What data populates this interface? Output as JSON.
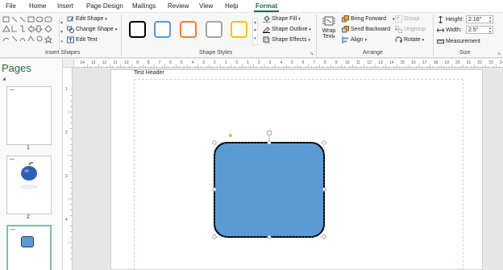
{
  "tabs": [
    {
      "label": "File"
    },
    {
      "label": "Home"
    },
    {
      "label": "Insert"
    },
    {
      "label": "Page Design"
    },
    {
      "label": "Mailings"
    },
    {
      "label": "Review"
    },
    {
      "label": "View"
    },
    {
      "label": "Help"
    },
    {
      "label": "Format",
      "active": true
    }
  ],
  "ribbon": {
    "insert_shapes": {
      "label": "Insert Shapes",
      "edit_shape": "Edit Shape",
      "change_shape": "Change Shape",
      "edit_text": "Edit Text"
    },
    "shape_styles": {
      "label": "Shape Styles",
      "swatch_colors": [
        "#000000",
        "#5b9bd5",
        "#ed7d31",
        "#a5a5a5",
        "#ffc000"
      ],
      "shape_fill": "Shape Fill",
      "shape_outline": "Shape Outline",
      "shape_effects": "Shape Effects"
    },
    "arrange": {
      "label": "Arrange",
      "wrap_text_line1": "Wrap",
      "wrap_text_line2": "Text",
      "bring_forward": "Bring Forward",
      "send_backward": "Send Backward",
      "align": "Align",
      "group": "Group",
      "ungroup": "Ungroup",
      "rotate": "Rotate"
    },
    "size": {
      "label": "Size",
      "height_label": "Height:",
      "height_value": "2.16\"",
      "width_label": "Width:",
      "width_value": "2.5\"",
      "measurement": "Measurement"
    }
  },
  "pages_pane": {
    "title": "Pages",
    "pages": [
      {
        "number": "1"
      },
      {
        "number": "2"
      },
      {
        "number": ""
      }
    ]
  },
  "rulers": {
    "horizontal_ticks": [
      "14",
      "13",
      "12",
      "11",
      "10",
      "9",
      "8",
      "7",
      "6",
      "5",
      "4",
      "3",
      "2",
      "1",
      "0",
      "1",
      "2",
      "3",
      "4",
      "5",
      "6",
      "7",
      "8",
      "9",
      "10",
      "11",
      "12",
      "13",
      "14",
      "15",
      "16",
      "17",
      "18",
      "19",
      "20",
      "21",
      "22",
      "23",
      "24"
    ],
    "vertical_ticks": [
      "1",
      "2",
      "3",
      "4"
    ]
  },
  "page": {
    "header_text": "Test Header",
    "shape_fill": "#5b9bd5",
    "shape_outline": "#000000"
  }
}
